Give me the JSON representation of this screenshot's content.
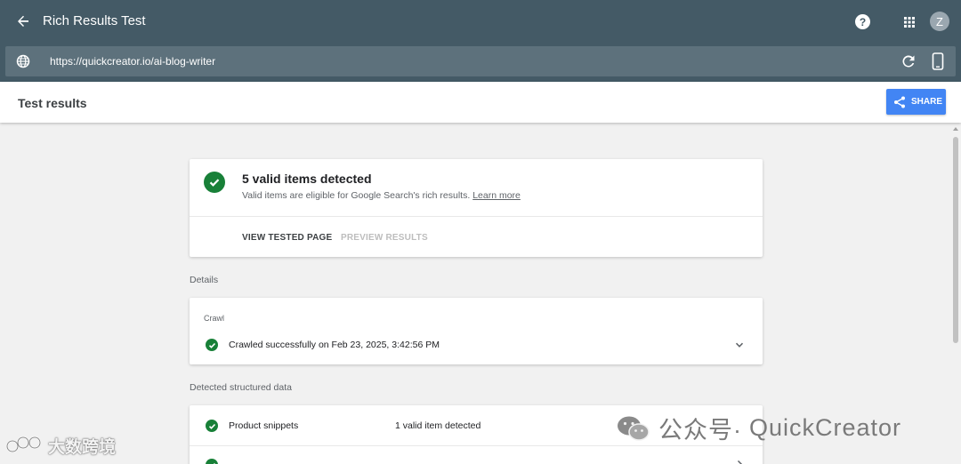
{
  "app": {
    "title": "Rich Results Test",
    "avatar_initial": "Z",
    "help_glyph": "?",
    "url": "https://quickcreator.io/ai-blog-writer",
    "icons": [
      "back-arrow-icon",
      "help-icon",
      "apps-grid-icon",
      "globe-icon",
      "reload-icon",
      "smartphone-icon",
      "share-icon"
    ]
  },
  "results_bar": {
    "title": "Test results",
    "share_label": "SHARE"
  },
  "summary": {
    "title": "5 valid items detected",
    "description": "Valid items are eligible for Google Search's rich results.",
    "learn_more": "Learn more",
    "actions": [
      "VIEW TESTED PAGE",
      "PREVIEW RESULTS"
    ]
  },
  "details": {
    "label": "Details",
    "crawl_label": "Crawl",
    "crawl_status": "Crawled successfully on Feb 23, 2025, 3:42:56 PM"
  },
  "structured_data": {
    "label": "Detected structured data",
    "items": [
      {
        "name": "Product snippets",
        "count": "1 valid item detected"
      }
    ]
  },
  "watermark": {
    "brand": "QuickCreator",
    "wechat_label": "公众号·",
    "left_text": "大数跨境"
  },
  "colors": {
    "appbar": "#445a66",
    "urlbar": "#5d717c",
    "share_button": "#4285f4",
    "valid_green": "#188038"
  }
}
